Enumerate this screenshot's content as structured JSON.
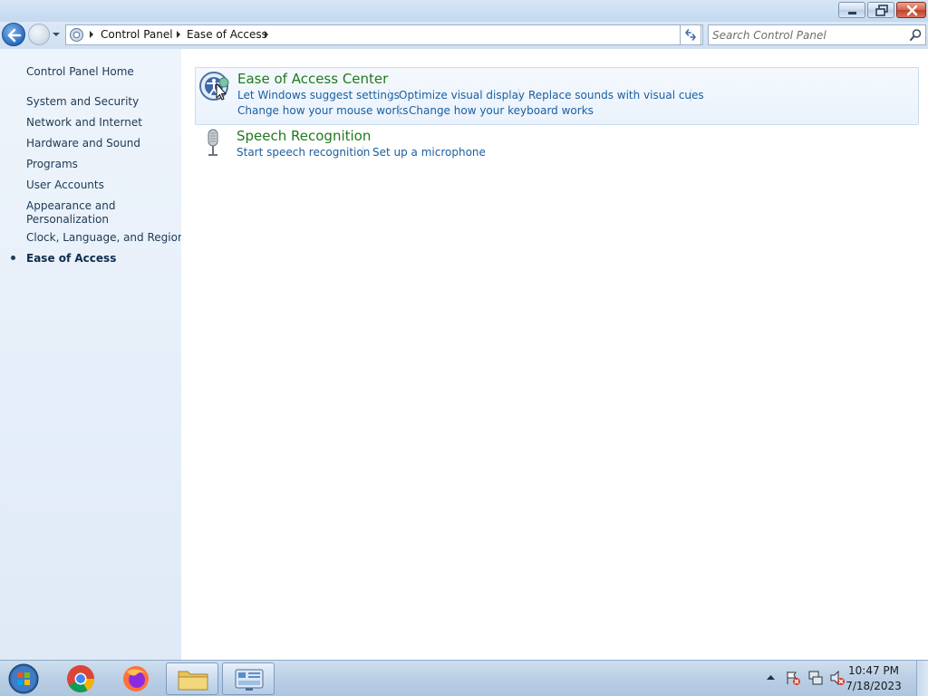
{
  "window": {
    "caption_buttons": {
      "minimize": "minimize",
      "maximize": "restore",
      "close": "close"
    }
  },
  "navbar": {
    "breadcrumbs": [
      "Control Panel",
      "Ease of Access"
    ],
    "search_placeholder": "Search Control Panel"
  },
  "sidebar": {
    "home": "Control Panel Home",
    "items": [
      {
        "label": "System and Security"
      },
      {
        "label": "Network and Internet"
      },
      {
        "label": "Hardware and Sound"
      },
      {
        "label": "Programs"
      },
      {
        "label": "User Accounts"
      },
      {
        "label": "Appearance and"
      },
      {
        "label": "Personalization"
      },
      {
        "label": "Clock, Language, and Region"
      },
      {
        "label": "Ease of Access",
        "current": true
      }
    ]
  },
  "categories": [
    {
      "title": "Ease of Access Center",
      "icon": "ease-of-access-icon",
      "links": [
        "Let Windows suggest settings",
        "Optimize visual display",
        "Replace sounds with visual cues",
        "Change how your mouse works",
        "Change how your keyboard works"
      ]
    },
    {
      "title": "Speech Recognition",
      "icon": "microphone-icon",
      "links": [
        "Start speech recognition",
        "Set up a microphone"
      ]
    }
  ],
  "taskbar": {
    "apps": [
      "start-orb",
      "chrome",
      "firefox",
      "file-explorer",
      "control-panel"
    ],
    "active_app": "control-panel",
    "clock_time": "10:47 PM",
    "clock_date": "7/18/2023",
    "tray_icons": [
      "action-center-alert-icon",
      "network-icon",
      "volume-muted-icon"
    ]
  },
  "colors": {
    "link": "#1a5fa0",
    "category_title": "#1f7a1f",
    "sidebar_bg": "#e7eff9"
  }
}
